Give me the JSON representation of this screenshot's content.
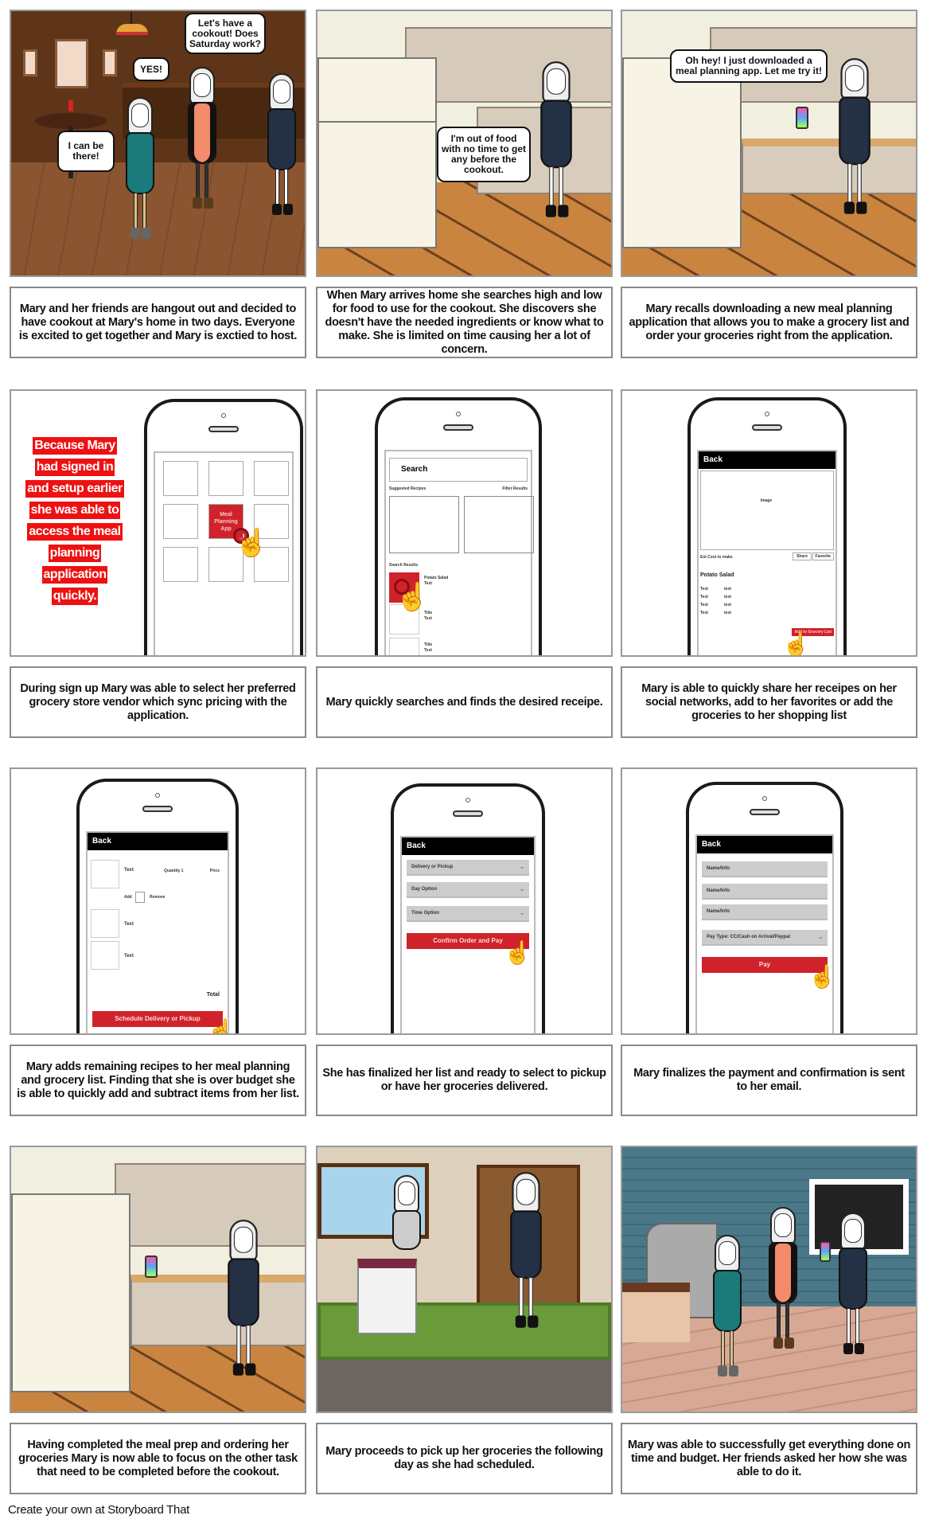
{
  "colors": {
    "accent_red": "#d0222a",
    "text_red_bg": "#ee1111",
    "bar_black": "#000000",
    "panel_border": "#9a9a9a"
  },
  "panels": [
    {
      "bubbles": [
        "Let's have a cookout! Does Saturday work?",
        "YES!",
        "I can be there!"
      ],
      "caption": "Mary and her friends are hangout out and decided to have cookout at Mary's home in two days. Everyone is excited to get together and Mary is exctied to host."
    },
    {
      "bubbles": [
        "I'm out of food with no time to get any before the cookout."
      ],
      "caption": "When Mary arrives home she searches high and low for food to use for the cookout. She discovers she doesn't have the needed ingredients or know what to make. She is limited on time causing her a lot of concern."
    },
    {
      "bubbles": [
        "Oh hey! I just downloaded a meal planning app. Let me try it!"
      ],
      "caption": "Mary recalls downloading a new meal planning application that allows you to make a grocery list and order your groceries right from the application."
    },
    {
      "red_text": [
        "Because Mary",
        "had signed in",
        "and setup earlier",
        "she was able to",
        "access the meal",
        "planning",
        "application",
        "quickly."
      ],
      "app_tile": "Meal Planning App",
      "caption": "During sign up Mary was able to select her preferred grocery store vendor which sync pricing with the application."
    },
    {
      "search_placeholder": "Search",
      "suggested": "Suggested Recipes",
      "filter": "Filter Results",
      "results_label": "Search Results",
      "results": [
        {
          "title": "Potato Salad",
          "sub": "Text"
        },
        {
          "title": "Title",
          "sub": "Text"
        },
        {
          "title": "Title",
          "sub": "Text"
        }
      ],
      "caption": "Mary quickly searches and finds the desired receipe."
    },
    {
      "back": "Back",
      "image": "Image",
      "cost": "Est Cost to make",
      "share": "Share",
      "favorite": "Favorite",
      "recipe": "Potato Salad",
      "rows": [
        [
          "Text",
          "text"
        ],
        [
          "Text",
          "text"
        ],
        [
          "Text",
          "text"
        ],
        [
          "Text",
          "text"
        ]
      ],
      "add_button": "Add to Grocery List",
      "caption": "Mary is able to quickly share her receipes on her social networks, add to her favorites or add the groceries to her shopping list"
    },
    {
      "back": "Back",
      "item_text": "Text",
      "quantity": "Quantity 1",
      "price": "Price",
      "add": "Add",
      "remove": "Remove",
      "total": "Total",
      "button": "Schedule Delivery or Pickup",
      "caption": "Mary adds remaining recipes to her meal planning and grocery list. Finding that she is over budget she is able to quickly add and subtract items from her list."
    },
    {
      "back": "Back",
      "fields": [
        "Delivery or Pickup",
        "Day Option",
        "Time Option"
      ],
      "button": "Confirm Order and Pay",
      "caption": "She has finalized her list and ready to select to pickup or have her groceries delivered."
    },
    {
      "back": "Back",
      "fields": [
        "Name/Info",
        "Name/Info",
        "Name/Info"
      ],
      "pay_type": "Pay Type: CC/Cash on Arrival/Paypal",
      "button": "Pay",
      "caption": "Mary finalizes the payment and confirmation is sent to her email."
    },
    {
      "caption": "Having completed the meal prep and ordering her groceries Mary is now able to focus on the other task that need to be completed before the cookout."
    },
    {
      "caption": "Mary proceeds to pick up her groceries the following day as she had scheduled."
    },
    {
      "caption": "Mary was able to successfully get everything done on time and budget. Her friends asked her how she was able to do it."
    }
  ],
  "footer": "Create your own at Storyboard That"
}
